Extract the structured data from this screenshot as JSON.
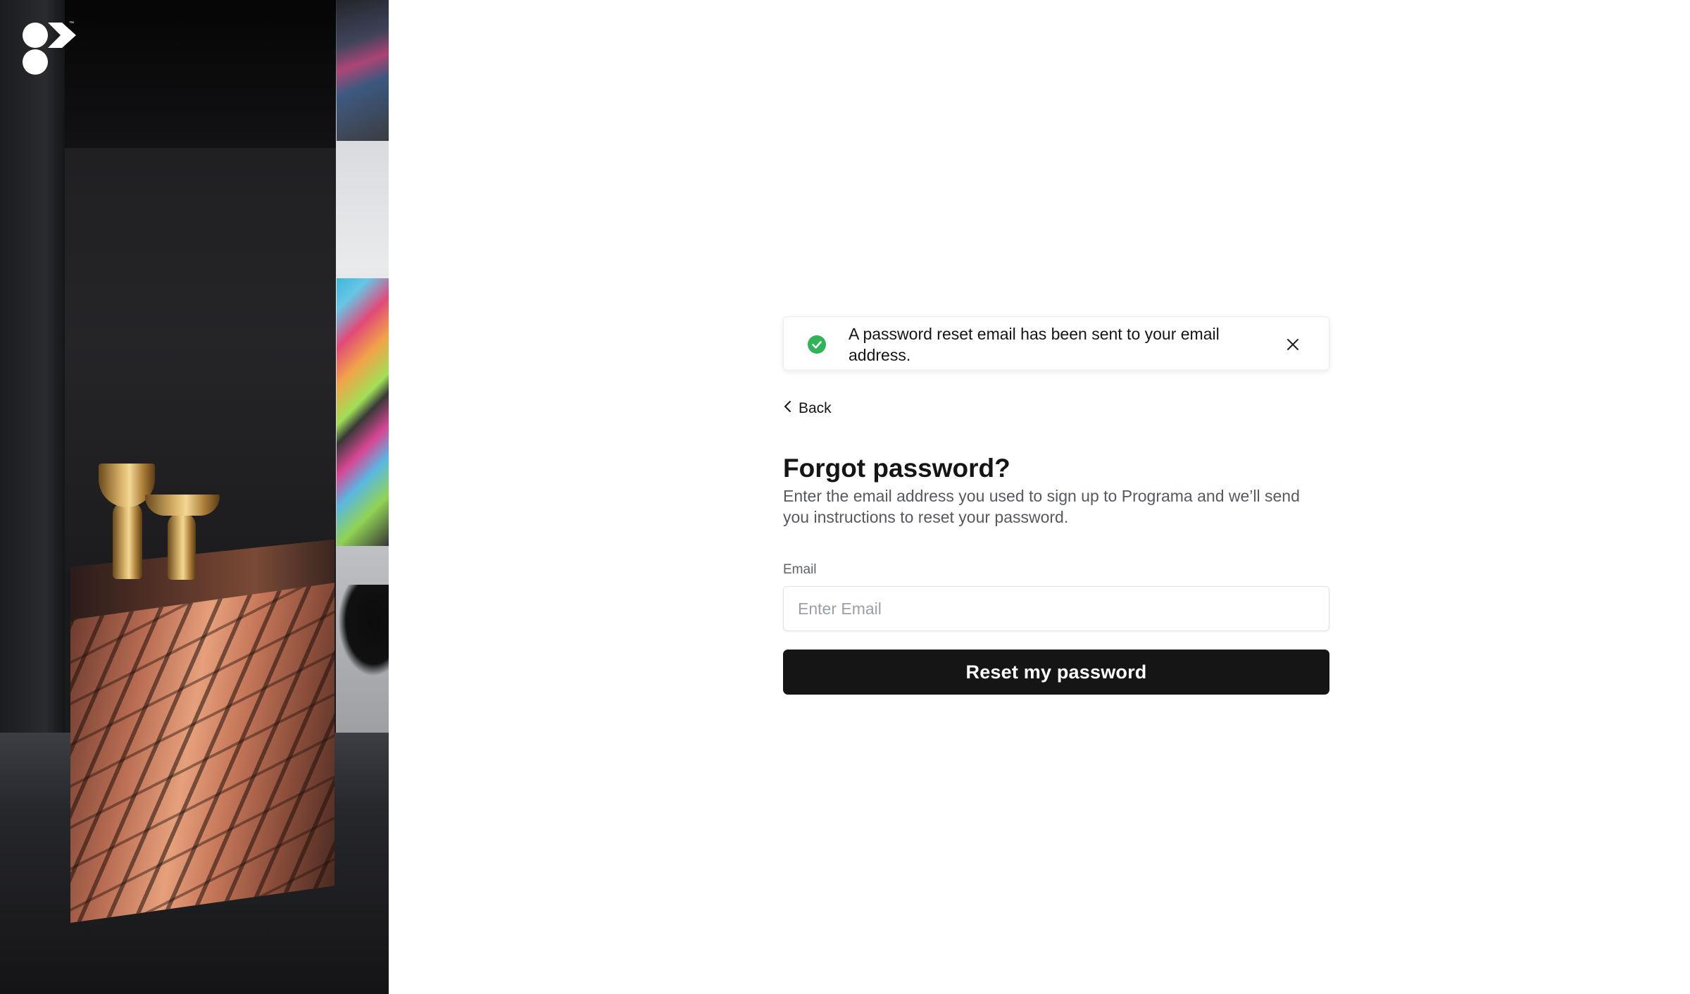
{
  "brand": {
    "logo_icon": "programa-logo-icon",
    "trademark": "™"
  },
  "toast": {
    "icon": "check-circle-icon",
    "message": "A password reset email has been sent to your email address.",
    "close_icon": "close-icon",
    "accent_color": "#2fb457"
  },
  "nav": {
    "back_icon": "chevron-left-icon",
    "back_label": "Back"
  },
  "form": {
    "title": "Forgot password?",
    "description": "Enter the email address you used to sign up to Programa and we’ll send you instructions to reset your password.",
    "email_label": "Email",
    "email_placeholder": "Enter Email",
    "email_value": "",
    "submit_label": "Reset my password",
    "submit_color": "#151515"
  }
}
